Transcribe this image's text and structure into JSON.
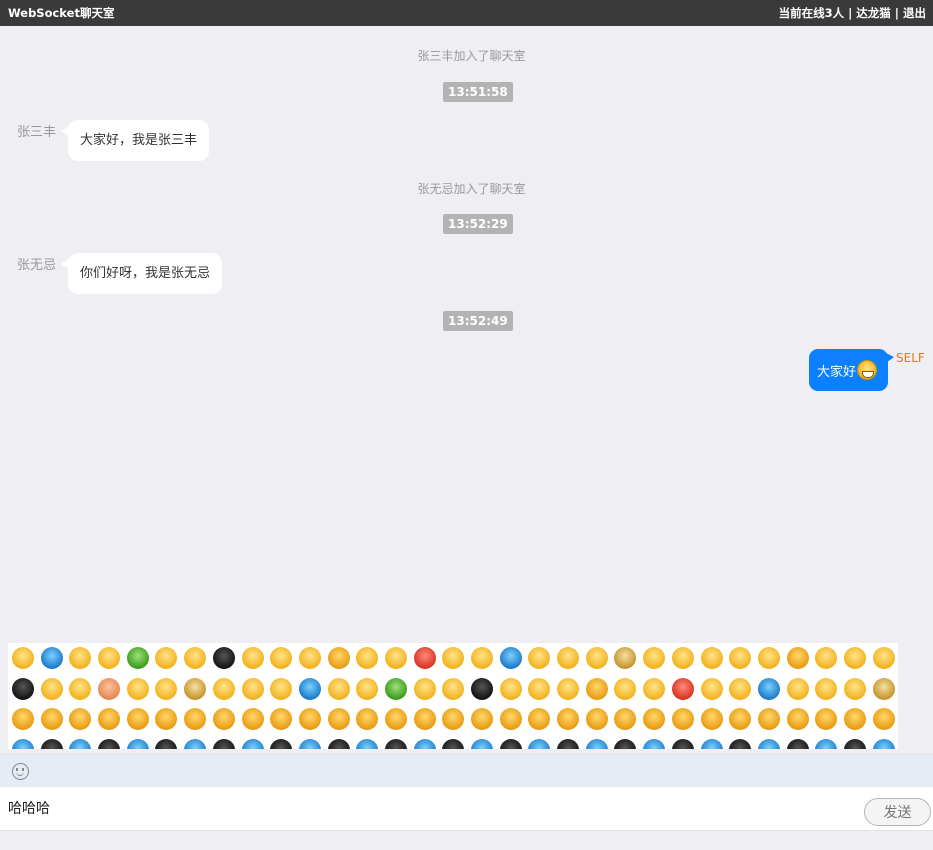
{
  "header": {
    "title": "WebSocket聊天室",
    "online_count": "当前在线3人",
    "username": "达龙猫",
    "logout": "退出",
    "separator": "|"
  },
  "messages": {
    "join_1": "张三丰加入了聊天室",
    "time_1": "13:51:58",
    "sender_1": "张三丰",
    "text_1": "大家好，我是张三丰",
    "join_2": "张无忌加入了聊天室",
    "time_2": "13:52:29",
    "sender_2": "张无忌",
    "text_2": "你们好呀，我是张无忌",
    "time_3": "13:52:49",
    "self_text": "大家好",
    "self_label": "SELF"
  },
  "composer": {
    "input_value": "哈哈哈",
    "send_label": "发送"
  },
  "colors": {
    "header_bg": "#3a3a3a",
    "self_bubble": "#0c80fe",
    "self_label": "#e07a1c",
    "page_bg": "#efeef3",
    "toolbar_bg": "#e5ecf5"
  },
  "emoji_icon": "smiley-face-icon"
}
